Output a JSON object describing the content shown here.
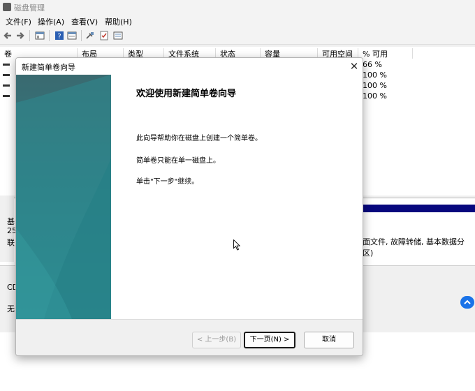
{
  "window": {
    "title": "磁盘管理"
  },
  "menu": [
    "文件(F)",
    "操作(A)",
    "查看(V)",
    "帮助(H)"
  ],
  "volume_columns": [
    "卷",
    "布局",
    "类型",
    "文件系统",
    "状态",
    "容量",
    "可用空间",
    "% 可用"
  ],
  "volume_rows": [
    {
      "pct_free": "66 %"
    },
    {
      "pct_free": "100 %"
    },
    {
      "pct_free": "100 %"
    },
    {
      "pct_free": "100 %"
    }
  ],
  "disk0": {
    "label_a": "基",
    "label_b": "25",
    "label_c": "联"
  },
  "partition_desc": "面文件, 故障转储, 基本数据分区)",
  "disk1": {
    "label_a": "CD",
    "label_b": "无"
  },
  "dialog": {
    "title": "新建简单卷向导",
    "heading": "欢迎使用新建简单卷向导",
    "para1": "此向导帮助你在磁盘上创建一个简单卷。",
    "para2": "简单卷只能在单一磁盘上。",
    "para3": "单击\"下一步\"继续。",
    "btn_prev": "< 上一步(B)",
    "btn_next": "下一页(N) >",
    "btn_cancel": "取消"
  },
  "colors": {
    "disk_bar": "#07087e",
    "accent": "#1a73e8",
    "banner": "#2e7b82"
  }
}
